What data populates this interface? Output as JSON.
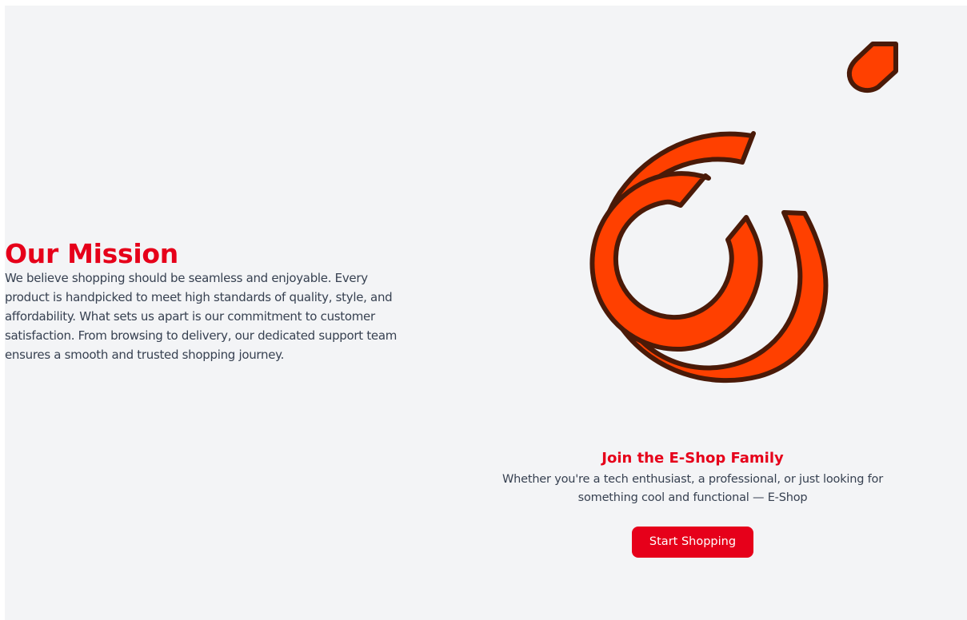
{
  "mission": {
    "title": "Our Mission",
    "body": "We believe shopping should be seamless and enjoyable. Every product is handpicked to meet high standards of quality, style, and affordability. What sets us apart is our commitment to customer satisfaction. From browsing to delivery, our dedicated support team ensures a smooth and trusted shopping journey."
  },
  "logo": {
    "icon": "concentric-rings-logo-icon",
    "fill_color": "#ff4000",
    "stroke_color": "#4a1a08"
  },
  "join": {
    "title": "Join the E-Shop Family",
    "body": "Whether you're a tech enthusiast, a professional, or just looking for something cool and functional — E-Shop",
    "button_label": "Start Shopping"
  },
  "colors": {
    "accent": "#e6001a",
    "background": "#f3f4f6",
    "text": "#374151"
  }
}
